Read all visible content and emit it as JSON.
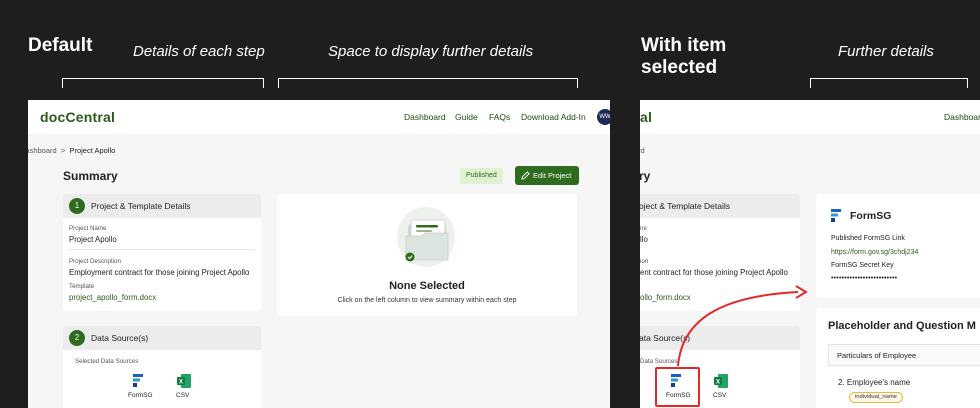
{
  "annotations": {
    "default_heading": "Default",
    "selected_heading_line1": "With item",
    "selected_heading_line2": "selected",
    "caption_details": "Details of each step",
    "caption_space": "Space to display further details",
    "caption_further": "Further details"
  },
  "left_panel": {
    "logo": "docCentral",
    "nav": [
      "Dashboard",
      "Guide",
      "FAQs",
      "Download Add-In"
    ],
    "avatar_initials": "WW",
    "breadcrumb_parent": "Dashboard",
    "breadcrumb_sep": ">",
    "breadcrumb_current": "Project Apollo",
    "title": "Summary",
    "status_badge": "Published",
    "edit_button": "Edit Project",
    "step1": {
      "number": "1",
      "title": "Project & Template Details",
      "project_name_label": "Project Name",
      "project_name": "Project Apollo",
      "project_desc_label": "Project Description",
      "project_desc": "Employment contract for those joining Project Apollo",
      "template_label": "Template",
      "template": "project_apollo_form.docx"
    },
    "step2": {
      "number": "2",
      "title": "Data Source(s)",
      "selected_label": "Selected Data Sources",
      "sources": [
        "FormSG",
        "CSV"
      ]
    },
    "empty_state": {
      "title": "None Selected",
      "subtitle": "Click on the left column to view summary within each step"
    }
  },
  "right_panel": {
    "logo_partial": "al",
    "nav_partial": "Dashboar",
    "breadcrumb_partial": "rd",
    "title_partial": "ry",
    "step1_title_partial": "oject & Template Details",
    "project_name_label_partial": "ne",
    "project_name_partial": "llo",
    "project_desc_label_partial": "ion",
    "project_desc_partial": "ent contract for those joining Project Apollo",
    "template_partial": "ollo_form.docx",
    "step2_title_partial": "ata Source(s)",
    "selected_label_partial": "Data Sources",
    "selected_source": "FormSG",
    "other_source": "CSV",
    "formsg_card": {
      "title": "FormSG",
      "link_label": "Published FormSG Link",
      "link": "https://form.gov.sg/3chdj234",
      "secret_label": "FormSG Secret Key",
      "secret": "•••••••••••••••••••••••••"
    },
    "placeholder_card": {
      "title": "Placeholder and Question M",
      "section": "Particulars of Employee",
      "question": "2. Employee's name",
      "tag": "individual_name"
    }
  },
  "colors": {
    "background": "#1e1e1e",
    "brand_green": "#2e6b1e",
    "highlight_red": "#e12a2a",
    "badge_bg": "#dff2cf"
  },
  "icons": {
    "edit": "pencil-icon",
    "formsg": "formsg-logo-icon",
    "csv": "excel-csv-icon",
    "empty": "folder-check-illustration",
    "arrow": "curved-arrow-icon"
  }
}
